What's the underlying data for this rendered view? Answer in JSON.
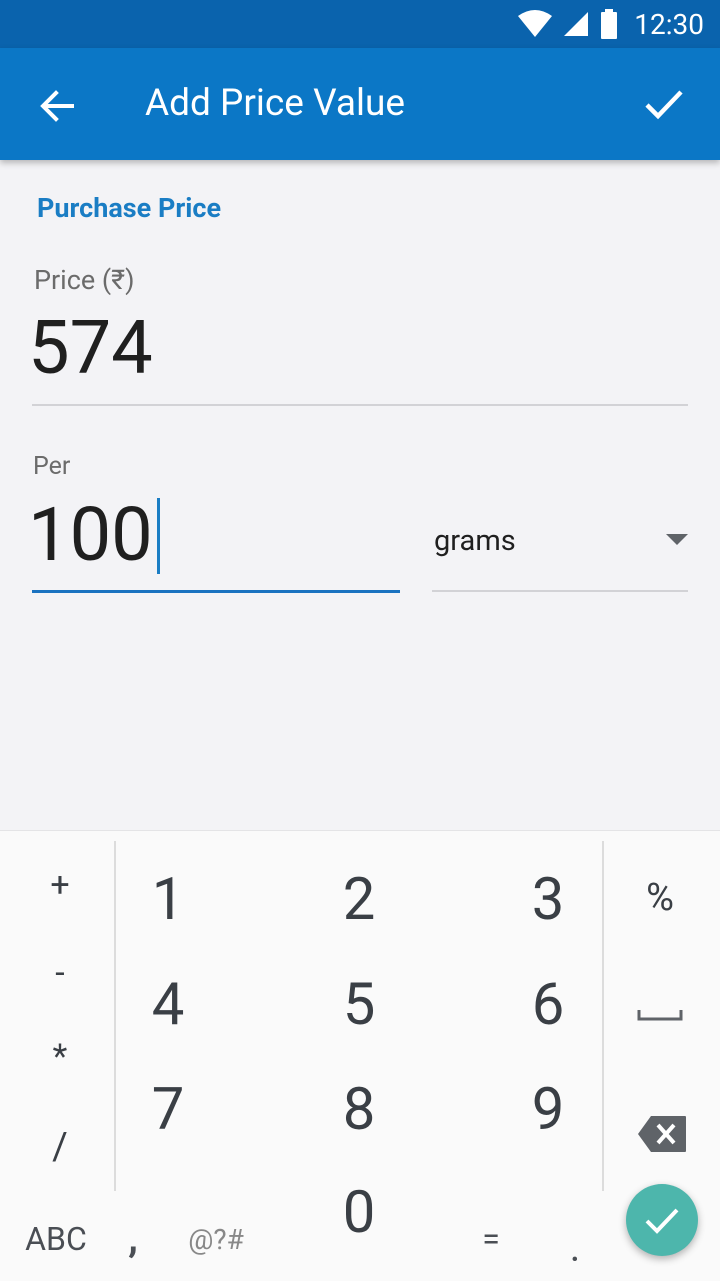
{
  "status_bar": {
    "time": "12:30"
  },
  "app_bar": {
    "title": "Add Price Value"
  },
  "form": {
    "section_title": "Purchase Price",
    "price_label": "Price (₹)",
    "price_value": "574",
    "per_label": "Per",
    "per_value": "100",
    "unit_selected": "grams"
  },
  "keypad": {
    "operators": [
      "+",
      "-",
      "*",
      "/"
    ],
    "digits": [
      "1",
      "2",
      "3",
      "4",
      "5",
      "6",
      "7",
      "8",
      "9",
      "0"
    ],
    "percent": "%",
    "abc": "ABC",
    "comma": ",",
    "symbols": "@?#",
    "equals": "=",
    "dot": "."
  },
  "colors": {
    "status_bar": "#0a63ad",
    "app_bar": "#0b77c6",
    "accent": "#1a7dc4",
    "fab": "#4db6ac"
  }
}
